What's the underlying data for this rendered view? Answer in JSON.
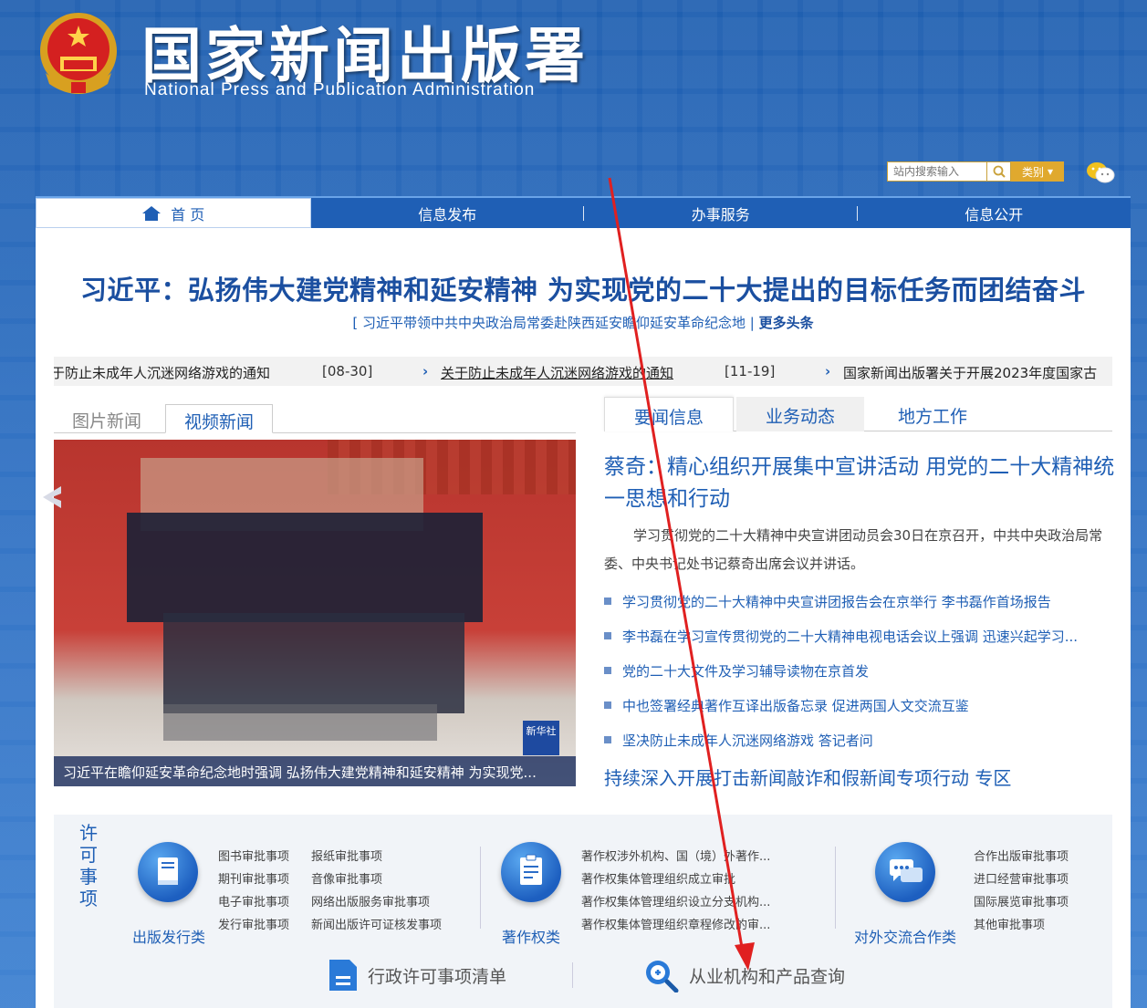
{
  "header": {
    "title": "国家新闻出版署",
    "subtitle": "National  Press and Publication Administration",
    "search_placeholder": "站内搜索输入",
    "category_label": "类别",
    "icons": [
      "emblem-icon",
      "search-icon",
      "wechat-icon"
    ]
  },
  "nav": {
    "items": [
      {
        "label": "首 页"
      },
      {
        "label": "信息发布"
      },
      {
        "label": "办事服务"
      },
      {
        "label": "信息公开"
      }
    ]
  },
  "headline": {
    "title": "习近平：弘扬伟大建党精神和延安精神 为实现党的二十大提出的目标任务而团结奋斗",
    "sub": "[ 习近平带领中共中央政治局常委赴陕西延安瞻仰延安革命纪念地 |",
    "more": "更多头条"
  },
  "ticker": [
    {
      "text": "关于防止未成年人沉迷网络游戏的通知",
      "date": "[08-30]"
    },
    {
      "text": "关于防止未成年人沉迷网络游戏的通知",
      "date": "[11-19]"
    },
    {
      "text": "国家新闻出版署关于开展2023年度国家古"
    }
  ],
  "left_tabs": [
    "图片新闻",
    "视频新闻"
  ],
  "video": {
    "caption": "习近平在瞻仰延安革命纪念地时强调 弘扬伟大建党精神和延安精神 为实现党...",
    "watermark": "新华社"
  },
  "right_tabs": [
    "要闻信息",
    "业务动态",
    "地方工作"
  ],
  "top_story": {
    "title": "蔡奇：精心组织开展集中宣讲活动 用党的二十大精神统一思想和行动",
    "summary": "学习贯彻党的二十大精神中央宣讲团动员会30日在京召开，中共中央政治局常委、中央书记处书记蔡奇出席会议并讲话。"
  },
  "news_list": [
    "学习贯彻党的二十大精神中央宣讲团报告会在京举行 李书磊作首场报告",
    "李书磊在学习宣传贯彻党的二十大精神电视电话会议上强调 迅速兴起学习...",
    "党的二十大文件及学习辅导读物在京首发",
    "中也签署经典著作互译出版备忘录 促进两国人文交流互鉴",
    "坚决防止未成年人沉迷网络游戏 答记者问"
  ],
  "special": "持续深入开展打击新闻敲诈和假新闻专项行动 专区",
  "permissions": {
    "title_chars": [
      "许",
      "可",
      "事",
      "项"
    ],
    "categories": [
      {
        "label": "出版发行类",
        "icon": "book-icon",
        "links": [
          "图书审批事项",
          "报纸审批事项",
          "期刊审批事项",
          "音像审批事项",
          "电子审批事项",
          "网络出版服务审批事项",
          "发行审批事项",
          "新闻出版许可证核发事项"
        ]
      },
      {
        "label": "著作权类",
        "icon": "clipboard-icon",
        "links": [
          "著作权涉外机构、国（境）外著作...",
          "著作权集体管理组织成立审批",
          "著作权集体管理组织设立分支机构...",
          "著作权集体管理组织章程修改的审..."
        ]
      },
      {
        "label": "对外交流合作类",
        "icon": "chat-icon",
        "links": [
          "合作出版审批事项",
          "进口经营审批事项",
          "国际展览审批事项",
          "其他审批事项"
        ]
      }
    ],
    "bottom": [
      {
        "label": "行政许可事项清单",
        "icon": "document-icon"
      },
      {
        "label": "从业机构和产品查询",
        "icon": "magnifier-icon"
      }
    ]
  },
  "colors": {
    "brand_blue": "#1f5fb5",
    "headline_blue": "#1b4fa0",
    "accent_gold": "#e0a92e",
    "annotation_red": "#e02020"
  }
}
